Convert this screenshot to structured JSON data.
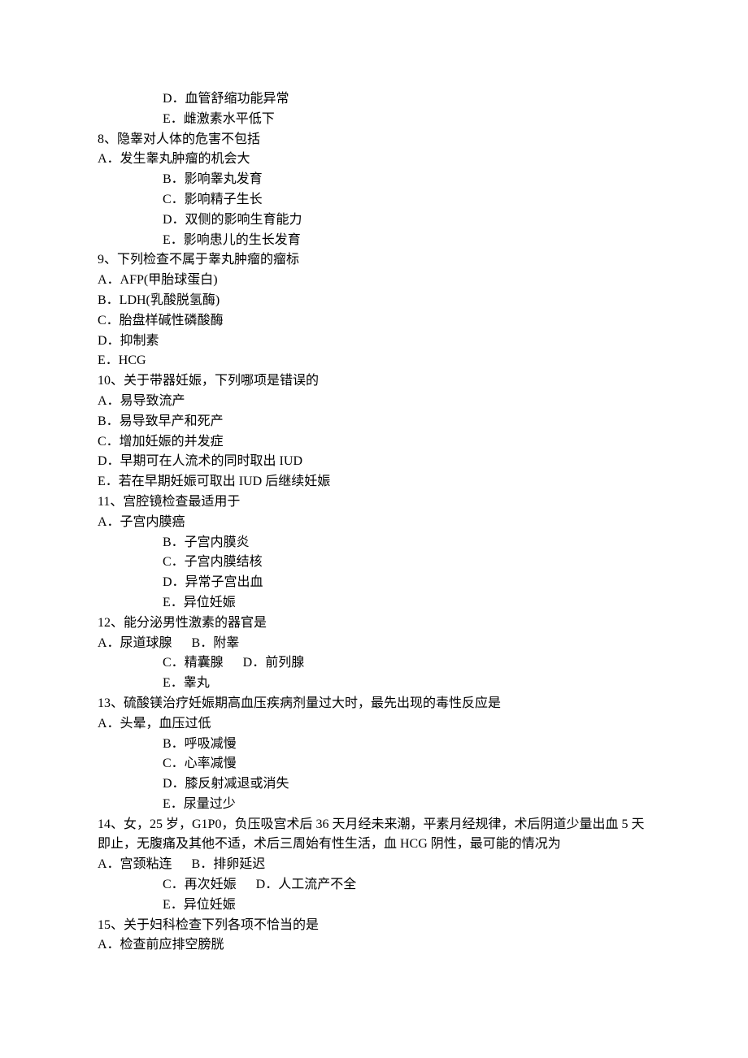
{
  "lines": [
    {
      "t": "D．血管舒缩功能异常",
      "indent": true
    },
    {
      "t": "E．雌激素水平低下",
      "indent": true
    },
    {
      "t": "8、隐睾对人体的危害不包括",
      "indent": false
    },
    {
      "t": "A．发生睾丸肿瘤的机会大",
      "indent": false
    },
    {
      "t": "B．影响睾丸发育",
      "indent": true
    },
    {
      "t": "C．影响精子生长",
      "indent": true
    },
    {
      "t": "D．双侧的影响生育能力",
      "indent": true
    },
    {
      "t": "E．影响患儿的生长发育",
      "indent": true
    },
    {
      "t": "9、下列检查不属于睾丸肿瘤的瘤标",
      "indent": false
    },
    {
      "t": "A．AFP(甲胎球蛋白)",
      "indent": false
    },
    {
      "t": "B．LDH(乳酸脱氢酶)",
      "indent": false
    },
    {
      "t": "C．胎盘样碱性磷酸酶",
      "indent": false
    },
    {
      "t": "D．抑制素",
      "indent": false
    },
    {
      "t": "E．HCG",
      "indent": false
    },
    {
      "t": "10、关于带器妊娠，下列哪项是错误的",
      "indent": false
    },
    {
      "t": "A．易导致流产",
      "indent": false
    },
    {
      "t": "B．易导致早产和死产",
      "indent": false
    },
    {
      "t": "C．增加妊娠的并发症",
      "indent": false
    },
    {
      "t": "D．早期可在人流术的同时取出 IUD",
      "indent": false
    },
    {
      "t": "E．若在早期妊娠可取出 IUD 后继续妊娠",
      "indent": false
    },
    {
      "t": "11、宫腔镜检查最适用于",
      "indent": false
    },
    {
      "t": "A．子宫内膜癌",
      "indent": false
    },
    {
      "t": "B．子宫内膜炎",
      "indent": true
    },
    {
      "t": "C．子宫内膜结核",
      "indent": true
    },
    {
      "t": "D．异常子宫出血",
      "indent": true
    },
    {
      "t": "E．异位妊娠",
      "indent": true
    },
    {
      "t": "12、能分泌男性激素的器官是",
      "indent": false
    },
    {
      "t": "A．尿道球腺      B．附睾",
      "indent": false
    },
    {
      "t": "C．精囊腺      D．前列腺",
      "indent": true
    },
    {
      "t": "E．睾丸",
      "indent": true
    },
    {
      "t": "13、硫酸镁治疗妊娠期高血压疾病剂量过大时，最先出现的毒性反应是",
      "indent": false
    },
    {
      "t": "A．头晕，血压过低",
      "indent": false
    },
    {
      "t": "B．呼吸减慢",
      "indent": true
    },
    {
      "t": "C．心率减慢",
      "indent": true
    },
    {
      "t": "D．膝反射减退或消失",
      "indent": true
    },
    {
      "t": "E．尿量过少",
      "indent": true
    },
    {
      "t": "14、女，25 岁，G1P0，负压吸宫术后 36 天月经未来潮，平素月经规律，术后阴道少量出血 5 天即止，无腹痛及其他不适，术后三周始有性生活，血 HCG 阴性，最可能的情况为",
      "indent": false
    },
    {
      "t": "A．宫颈粘连      B．排卵延迟",
      "indent": false
    },
    {
      "t": "C．再次妊娠      D．人工流产不全",
      "indent": true
    },
    {
      "t": "E．异位妊娠",
      "indent": true
    },
    {
      "t": "15、关于妇科检查下列各项不恰当的是",
      "indent": false
    },
    {
      "t": "A．检查前应排空膀胱",
      "indent": false
    }
  ]
}
